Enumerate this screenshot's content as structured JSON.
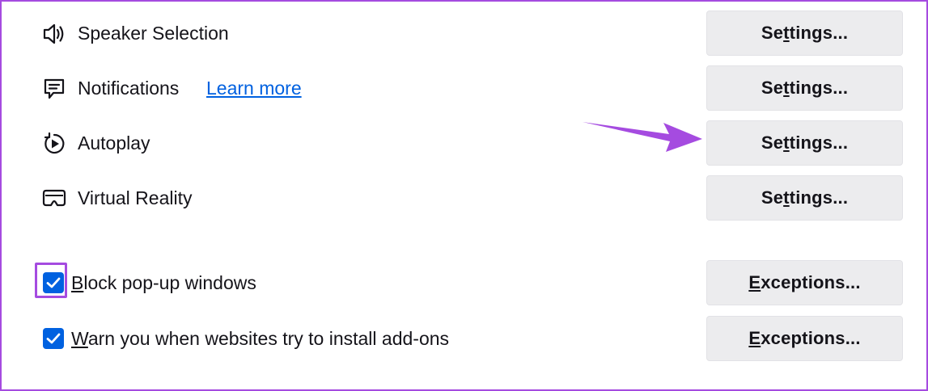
{
  "permissions": [
    {
      "icon": "speaker-icon",
      "label": "Speaker Selection",
      "link": "",
      "button": {
        "pre": "Se",
        "acc": "t",
        "post": "tings..."
      }
    },
    {
      "icon": "notification-icon",
      "label": "Notifications",
      "link": "Learn more",
      "button": {
        "pre": "Se",
        "acc": "t",
        "post": "tings..."
      }
    },
    {
      "icon": "autoplay-icon",
      "label": "Autoplay",
      "link": "",
      "button": {
        "pre": "Se",
        "acc": "t",
        "post": "tings..."
      }
    },
    {
      "icon": "vr-headset-icon",
      "label": "Virtual Reality",
      "link": "",
      "button": {
        "pre": "Se",
        "acc": "t",
        "post": "tings..."
      }
    }
  ],
  "checkboxes": [
    {
      "acc": "B",
      "rest": "lock pop-up windows",
      "checked": true,
      "button": {
        "acc": "E",
        "post": "xceptions..."
      }
    },
    {
      "acc": "W",
      "rest": "arn you when websites try to install add-ons",
      "checked": true,
      "button": {
        "acc": "E",
        "post": "xceptions..."
      }
    }
  ],
  "colors": {
    "accent": "#0061e0",
    "annotation": "#a54be0",
    "button_bg": "#ececee"
  }
}
